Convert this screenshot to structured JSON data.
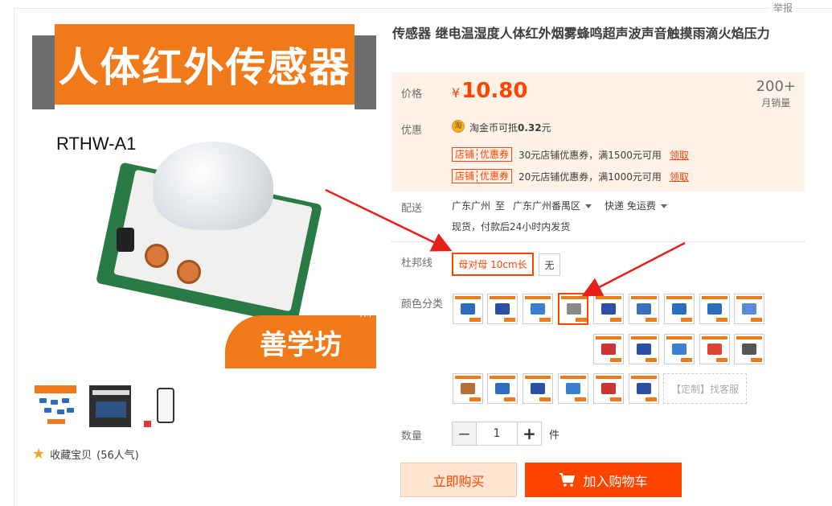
{
  "report": "举报",
  "product": {
    "title": "传感器 继电温湿度人体红外烟雾蜂鸣超声波声音触摸雨滴火焰压力",
    "image": {
      "banner_text": "人体红外传感器",
      "model": "RTHW-A1",
      "brand": "善学坊",
      "tm": "TM"
    },
    "favorite": {
      "label": "收藏宝贝",
      "count": "(56人气)"
    }
  },
  "price": {
    "label": "价格",
    "currency": "¥",
    "value": "10.80"
  },
  "sales": {
    "count": "200+",
    "unit": "月销量"
  },
  "promo": {
    "label": "优惠",
    "coin_icon": "淘",
    "coin_text": "淘金币可抵",
    "coin_value": "0.32",
    "coin_unit": "元",
    "coupons": [
      {
        "tag_a": "店铺",
        "tag_b": "优惠券",
        "text": "30元店铺优惠券，满1500元可用",
        "action": "领取"
      },
      {
        "tag_a": "店铺",
        "tag_b": "优惠券",
        "text": "20元店铺优惠券，满1000元可用",
        "action": "领取"
      }
    ]
  },
  "shipping": {
    "label": "配送",
    "from": "广东广州",
    "to_word": "至",
    "to": "广东广州番禺区",
    "method": "快递 免运费",
    "note": "现货，付款后24小时内发货"
  },
  "dupont": {
    "label": "杜邦线",
    "options": [
      "母对母 10cm长",
      "无"
    ],
    "selected": "母对母 10cm长"
  },
  "color": {
    "label": "颜色分类",
    "more": "【定制】找客服"
  },
  "quantity": {
    "label": "数量",
    "minus": "−",
    "value": "1",
    "plus": "+",
    "unit": "件"
  },
  "actions": {
    "buy": "立即购买",
    "cart": "加入购物车"
  },
  "colors": {
    "accent": "#ff4400",
    "orange": "#f07a1a",
    "price_bg": "#fff2e8"
  }
}
